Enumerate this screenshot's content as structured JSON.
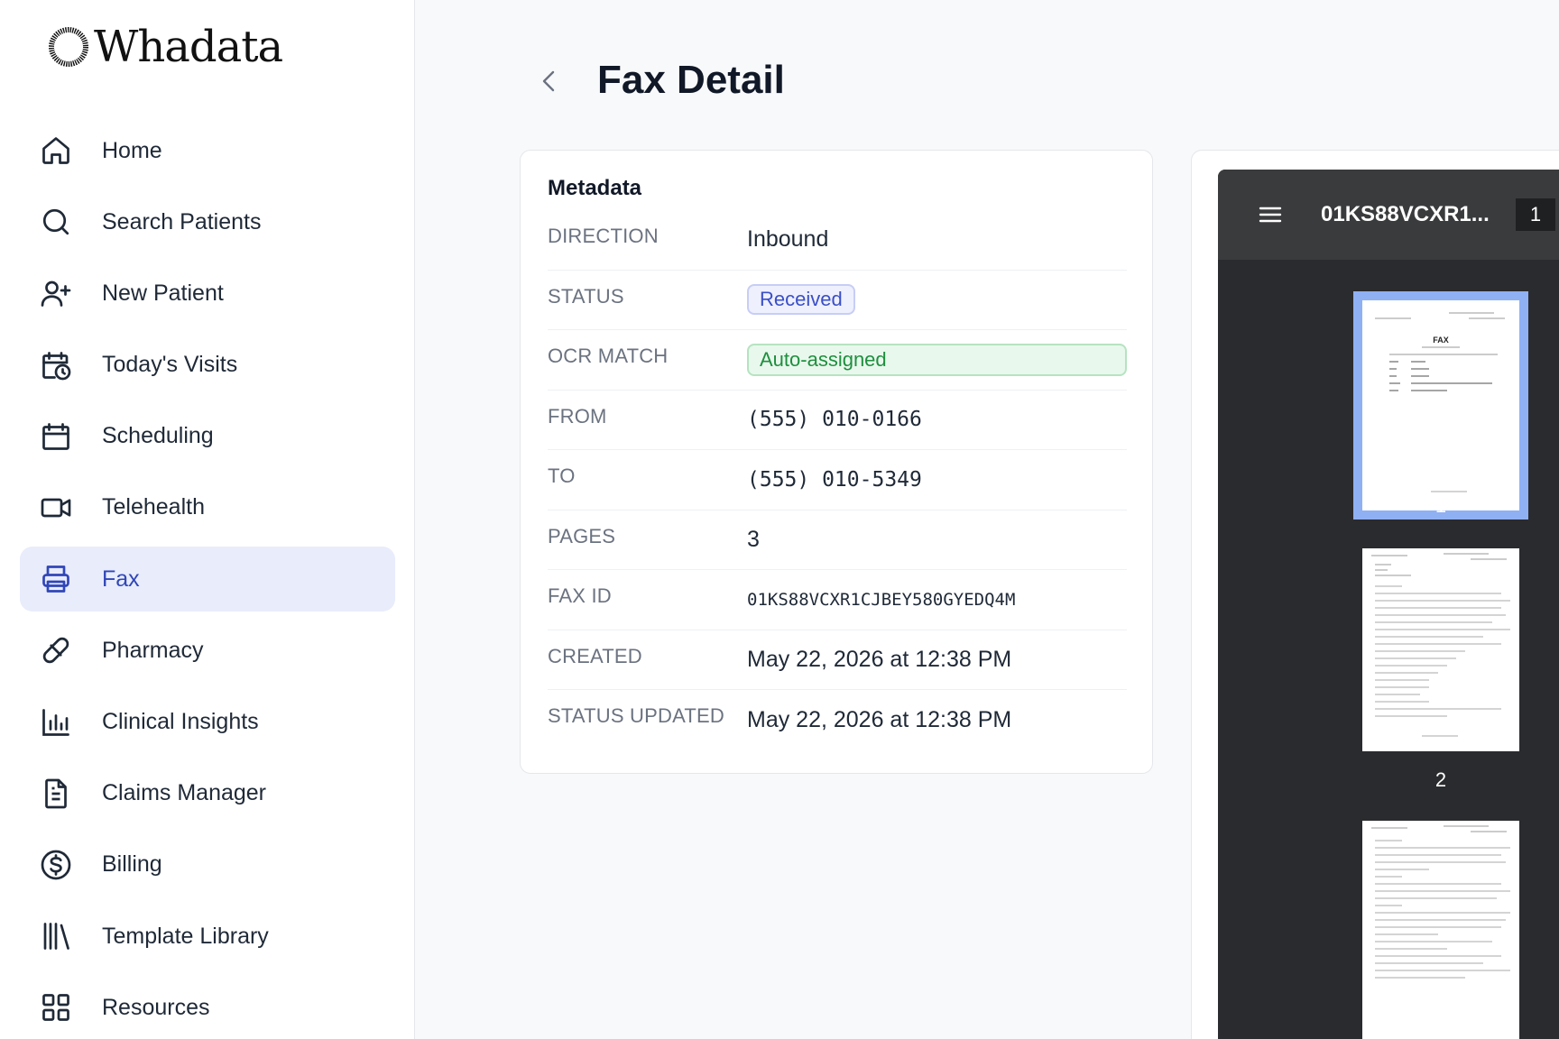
{
  "brand": {
    "name": "Whadata"
  },
  "sidebar": {
    "items": [
      {
        "label": "Home",
        "icon": "home-icon"
      },
      {
        "label": "Search Patients",
        "icon": "search-icon"
      },
      {
        "label": "New Patient",
        "icon": "user-plus-icon"
      },
      {
        "label": "Today's Visits",
        "icon": "calendar-clock-icon"
      },
      {
        "label": "Scheduling",
        "icon": "calendar-icon"
      },
      {
        "label": "Telehealth",
        "icon": "video-icon"
      },
      {
        "label": "Fax",
        "icon": "printer-icon",
        "active": true
      },
      {
        "label": "Pharmacy",
        "icon": "pill-icon"
      },
      {
        "label": "Clinical Insights",
        "icon": "bar-chart-icon"
      },
      {
        "label": "Claims Manager",
        "icon": "file-text-icon"
      },
      {
        "label": "Billing",
        "icon": "dollar-circle-icon"
      },
      {
        "label": "Template Library",
        "icon": "library-icon"
      },
      {
        "label": "Resources",
        "icon": "grid-icon"
      }
    ]
  },
  "header": {
    "title": "Fax Detail"
  },
  "metadata": {
    "title": "Metadata",
    "rows": [
      {
        "key": "DIRECTION",
        "value": "Inbound"
      },
      {
        "key": "STATUS",
        "value": "Received"
      },
      {
        "key": "OCR MATCH",
        "value": "Auto-assigned"
      },
      {
        "key": "FROM",
        "value": "(555) 010-0166"
      },
      {
        "key": "TO",
        "value": "(555) 010-5349"
      },
      {
        "key": "PAGES",
        "value": "3"
      },
      {
        "key": "FAX ID",
        "value": "01KS88VCXR1CJBEY580GYEDQ4M"
      },
      {
        "key": "CREATED",
        "value": "May 22, 2026 at 12:38 PM"
      },
      {
        "key": "STATUS UPDATED",
        "value": "May 22, 2026 at 12:38 PM"
      }
    ]
  },
  "viewer": {
    "title": "01KS88VCXR1...",
    "current_page": "1",
    "thumb_labels": [
      "1",
      "2"
    ],
    "page1_heading": "FAX"
  },
  "colors": {
    "accent": "#3046b8",
    "active_bg": "#e8ecfb",
    "success": "#1e8f3e",
    "viewer_bg": "#2a2b2e"
  }
}
